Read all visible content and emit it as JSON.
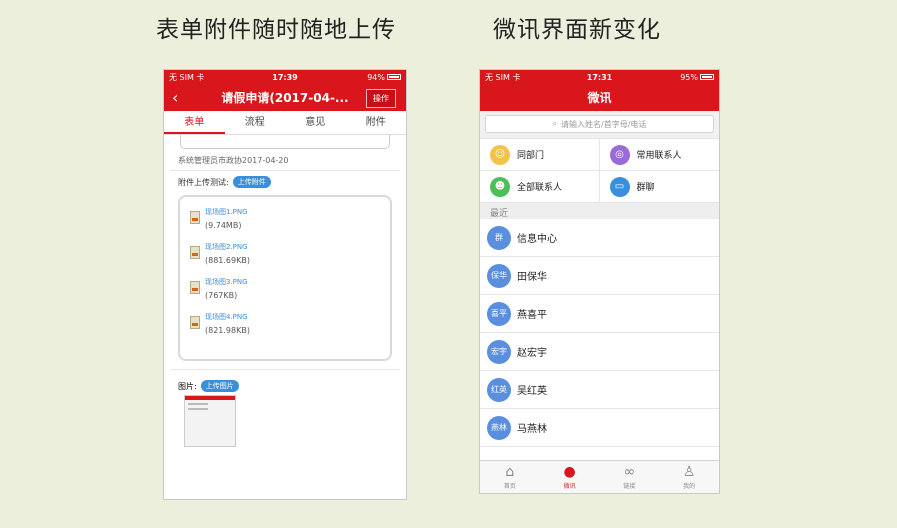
{
  "captions": {
    "left": "表单附件随时随地上传",
    "right": "微讯界面新变化"
  },
  "left_phone": {
    "status": {
      "carrier": "无 SIM 卡",
      "time": "17:39",
      "battery": "94%"
    },
    "nav": {
      "title": "请假申请(2017-04-...",
      "action": "操作"
    },
    "tabs": [
      "表单",
      "流程",
      "意见",
      "附件"
    ],
    "meta": "系统管理员市政协2017-04-20",
    "upload_label": "附件上传测试:",
    "upload_button": "上传附件",
    "attachments": [
      {
        "name": "现场图1.PNG",
        "size": "(9.74MB)"
      },
      {
        "name": "现场图2.PNG",
        "size": "(881.69KB)"
      },
      {
        "name": "现场图3.PNG",
        "size": "(767KB)"
      },
      {
        "name": "现场图4.PNG",
        "size": "(821.98KB)"
      }
    ],
    "picture_label": "图片:",
    "picture_button": "上传图片"
  },
  "right_phone": {
    "status": {
      "carrier": "无 SIM 卡",
      "time": "17:31",
      "battery": "95%"
    },
    "nav": {
      "title": "微讯"
    },
    "search": {
      "placeholder": "请输入姓名/首字母/电话"
    },
    "quick": [
      {
        "label": "同部门",
        "color": "#f2c24d",
        "icon": "person-icon"
      },
      {
        "label": "常用联系人",
        "color": "#9a6ad8",
        "icon": "person-circle-icon"
      },
      {
        "label": "全部联系人",
        "color": "#4cbf5a",
        "icon": "people-icon"
      },
      {
        "label": "群聊",
        "color": "#3a8fdc",
        "icon": "folder-icon"
      }
    ],
    "section": "最近",
    "contacts": [
      {
        "avatar": "群",
        "name": "信息中心"
      },
      {
        "avatar": "保华",
        "name": "田保华"
      },
      {
        "avatar": "喜平",
        "name": "燕喜平"
      },
      {
        "avatar": "宏宇",
        "name": "赵宏宇"
      },
      {
        "avatar": "红英",
        "name": "吴红英"
      },
      {
        "avatar": "燕林",
        "name": "马燕林"
      }
    ],
    "tabbar": [
      "首页",
      "微讯",
      "链接",
      "我的"
    ]
  }
}
